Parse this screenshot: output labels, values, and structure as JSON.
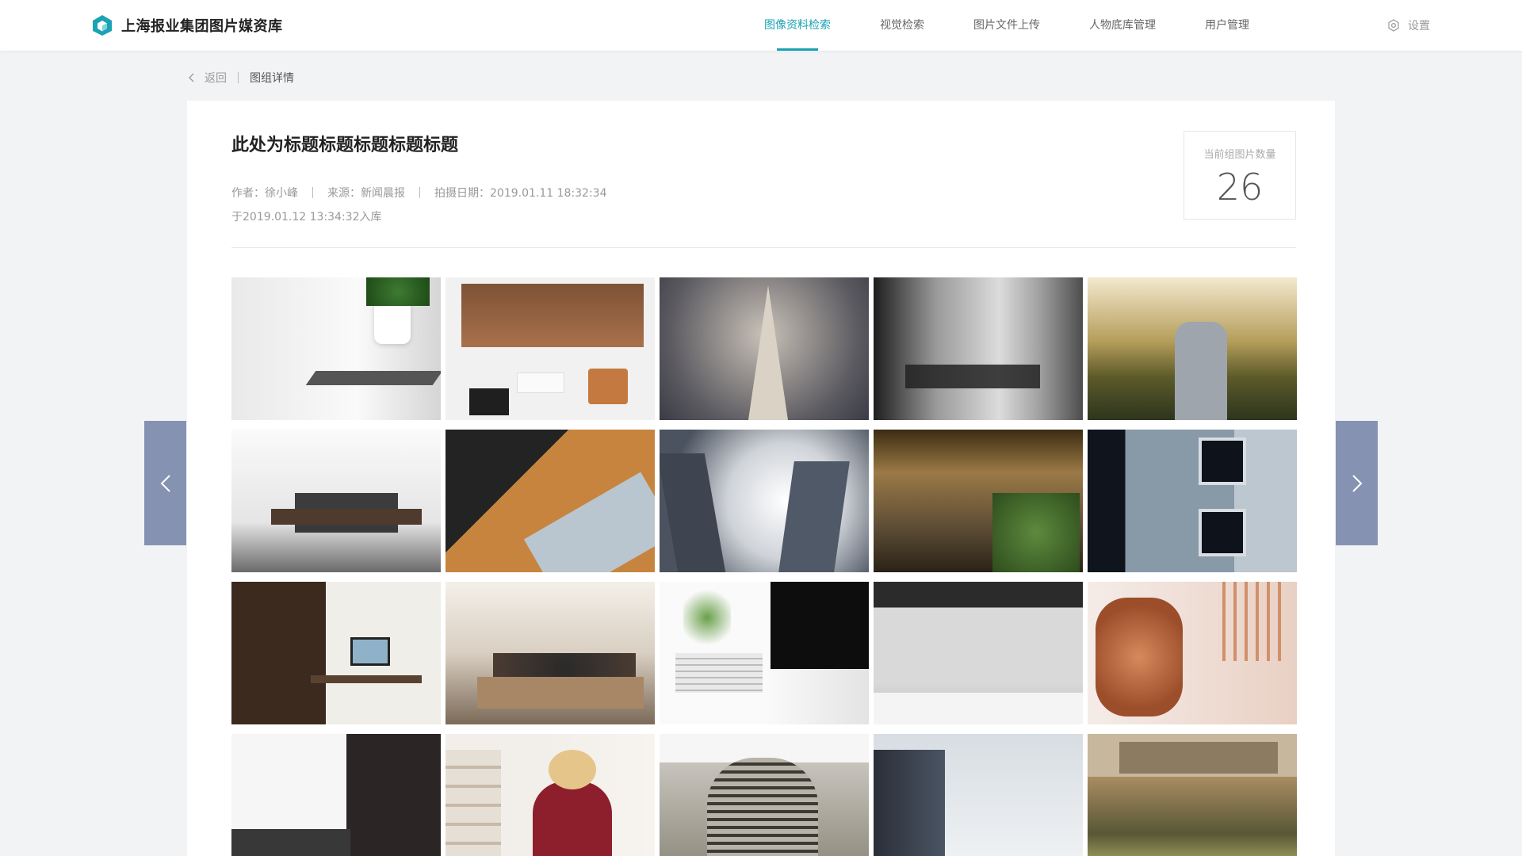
{
  "app": {
    "title": "上海报业集团图片媒资库"
  },
  "nav": {
    "items": [
      {
        "label": "图像资料检索",
        "active": true
      },
      {
        "label": "视觉检索",
        "active": false
      },
      {
        "label": "图片文件上传",
        "active": false
      },
      {
        "label": "人物底库管理",
        "active": false
      },
      {
        "label": "用户管理",
        "active": false
      }
    ],
    "settings_label": "设置"
  },
  "breadcrumb": {
    "back_label": "返回",
    "current_label": "图组详情"
  },
  "detail": {
    "title": "此处为标题标题标题标题标题",
    "author": "作者：徐小峰",
    "source": "来源：新闻晨报",
    "shot_date": "拍摄日期：2019.01.11 18:32:34",
    "ingest_time": "于2019.01.12 13:34:32入库",
    "count_label": "当前组图片数量",
    "count_value": "26"
  },
  "thumbnails": [
    {
      "icon": "desk-plant-notebook"
    },
    {
      "icon": "desk-flatlay"
    },
    {
      "icon": "aerial-city-tower"
    },
    {
      "icon": "glass-meeting-room"
    },
    {
      "icon": "man-walking-field"
    },
    {
      "icon": "conference-table-bright"
    },
    {
      "icon": "laptop-keyboard-wood"
    },
    {
      "icon": "skyscrapers-sky"
    },
    {
      "icon": "office-interior-gold"
    },
    {
      "icon": "building-facade-windows"
    },
    {
      "icon": "home-office-shelf"
    },
    {
      "icon": "team-meeting"
    },
    {
      "icon": "imac-books-plant"
    },
    {
      "icon": "open-plan-office"
    },
    {
      "icon": "push-pins-jar"
    },
    {
      "icon": "city-towers-mist"
    },
    {
      "icon": "woman-laptop"
    },
    {
      "icon": "round-tower"
    },
    {
      "icon": "tall-glass-tower"
    },
    {
      "icon": "wood-desk-chair"
    }
  ],
  "colors": {
    "accent": "#1ba2b4",
    "pager": "#8592b1",
    "background": "#f2f3f5"
  }
}
